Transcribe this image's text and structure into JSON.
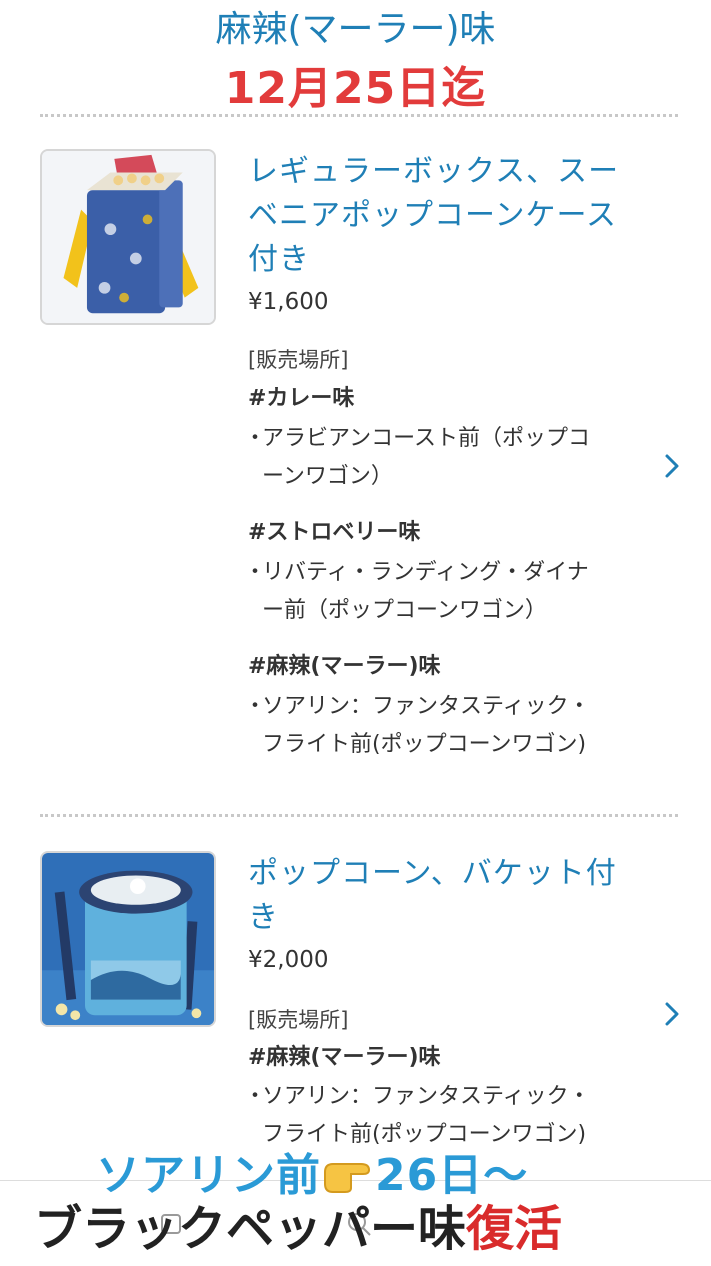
{
  "header": {
    "title": "麻辣(マーラー)味",
    "date": "12月25日迄"
  },
  "products": [
    {
      "name_lines": [
        "レギュラーボックス、スー",
        "ベニアポップコーンケース",
        "付き"
      ],
      "price": "¥1,600",
      "shop_heading": "[販売場所]",
      "flavors": [
        {
          "title": "#カレー味",
          "bullet": "・",
          "lines": [
            "アラビアンコースト前（ポップコ",
            "ーンワゴン）"
          ]
        },
        {
          "title": "#ストロベリー味",
          "bullet": "・",
          "lines": [
            "リバティ・ランディング・ダイナ",
            "ー前（ポップコーンワゴン）"
          ]
        },
        {
          "title": "#麻辣(マーラー)味",
          "bullet": "・",
          "lines": [
            "ソアリン：ファンタスティック・",
            "フライト前(ポップコーンワゴン)"
          ]
        }
      ]
    },
    {
      "name_lines": [
        "ポップコーン、バケット付",
        "き"
      ],
      "price": "¥2,000",
      "shop_heading": "[販売場所]",
      "flavors": [
        {
          "title": "#麻辣(マーラー)味",
          "bullet": "・",
          "lines": [
            "ソアリン：ファンタスティック・",
            "フライト前(ポップコーンワゴン)"
          ]
        }
      ]
    }
  ],
  "overlay": {
    "line1_a": "ソアリン前",
    "hand_icon": "pointing-hand-emoji",
    "line1_b": "26日〜",
    "line2_a": "ブラックペッパー味",
    "line2_b": "復活"
  },
  "colors": {
    "link_blue": "#1f7fb6",
    "date_red": "#e23b3b",
    "overlay_blue": "#2a9ad6",
    "overlay_red": "#d92b2b"
  }
}
